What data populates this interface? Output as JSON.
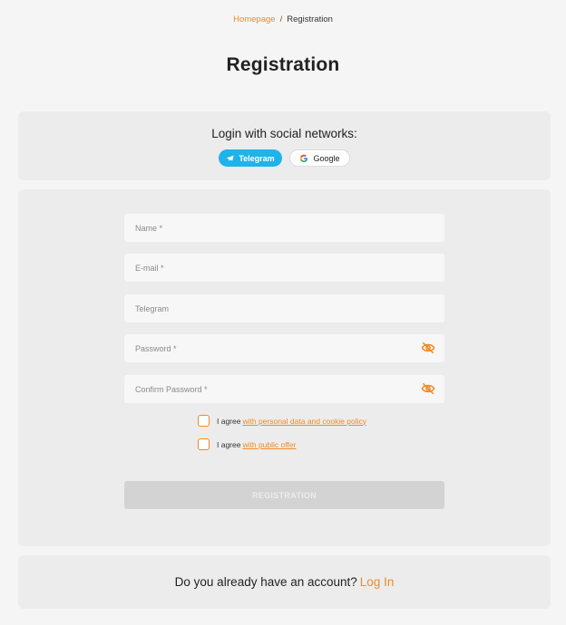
{
  "breadcrumb": {
    "home": "Homepage",
    "separator": "/",
    "current": "Registration"
  },
  "page_title": "Registration",
  "social": {
    "title": "Login with social networks:",
    "telegram_label": "Telegram",
    "google_label": "Google"
  },
  "form": {
    "name_placeholder": "Name *",
    "email_placeholder": "E-mail *",
    "telegram_placeholder": "Telegram",
    "password_placeholder": "Password *",
    "confirm_password_placeholder": "Confirm Password *",
    "agree_prefix": "I agree",
    "policy_link": "with personal data and cookie policy",
    "offer_link": "with public offer",
    "submit_label": "REGISTRATION"
  },
  "account": {
    "question": "Do you already have an account?",
    "login_link": "Log In"
  },
  "colors": {
    "accent": "#f08a24",
    "telegram": "#1fb3ea",
    "card": "#ececec",
    "background": "#f5f5f5"
  }
}
